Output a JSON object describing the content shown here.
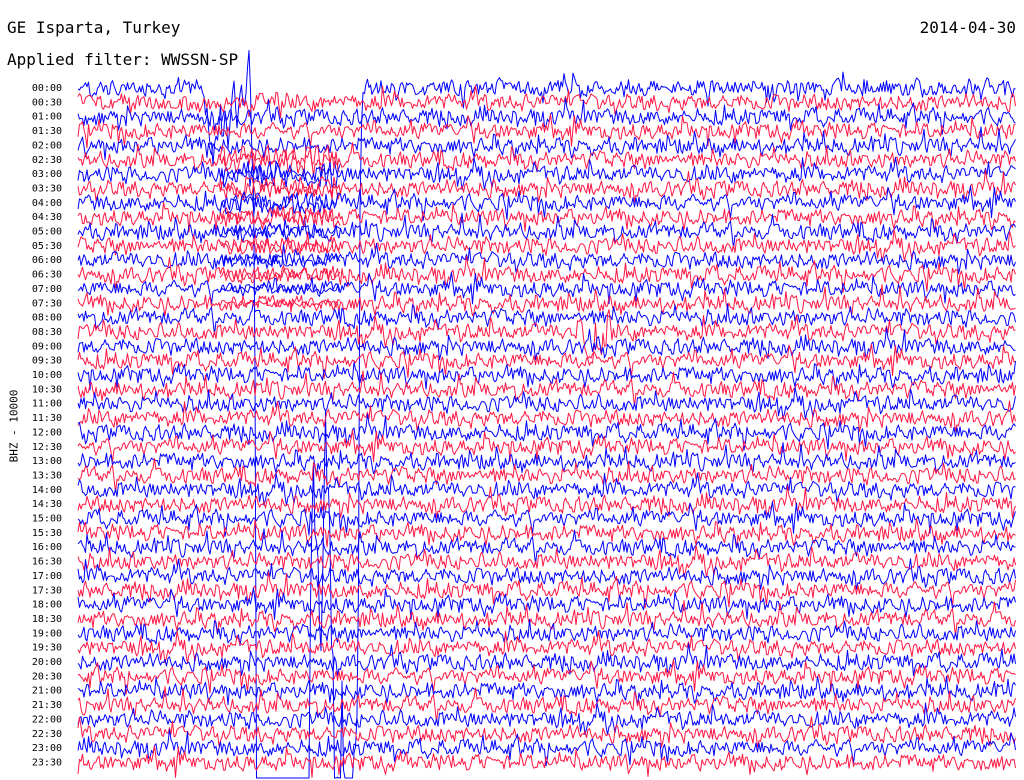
{
  "header": {
    "station": "GE Isparta, Turkey",
    "filter": "Applied filter: WWSSN-SP",
    "date": "2014-04-30"
  },
  "chart_data": {
    "type": "line",
    "title": "GE Isparta, Turkey",
    "subtitle": "Applied filter: WWSSN-SP",
    "date": "2014-04-30",
    "ylabel": "BHZ - 10000",
    "row_labels": [
      "00:00",
      "00:30",
      "01:00",
      "01:30",
      "02:00",
      "02:30",
      "03:00",
      "03:30",
      "04:00",
      "04:30",
      "05:00",
      "05:30",
      "06:00",
      "06:30",
      "07:00",
      "07:30",
      "08:00",
      "08:30",
      "09:00",
      "09:30",
      "10:00",
      "10:30",
      "11:00",
      "11:30",
      "12:00",
      "12:30",
      "13:00",
      "13:30",
      "14:00",
      "14:30",
      "15:00",
      "15:30",
      "16:00",
      "16:30",
      "17:00",
      "17:30",
      "18:00",
      "18:30",
      "19:00",
      "19:30",
      "20:00",
      "20:30",
      "21:00",
      "21:30",
      "22:00",
      "22:30",
      "23:00",
      "23:30"
    ],
    "row_colors": [
      "#0000ff",
      "#ff1744"
    ],
    "legend": "none",
    "grid": false,
    "events": [
      {
        "row": "00:00",
        "minute": 6.5,
        "amplitude": "saturated"
      },
      {
        "row": "08:30",
        "minute": 16.5,
        "amplitude": "moderate"
      }
    ]
  }
}
